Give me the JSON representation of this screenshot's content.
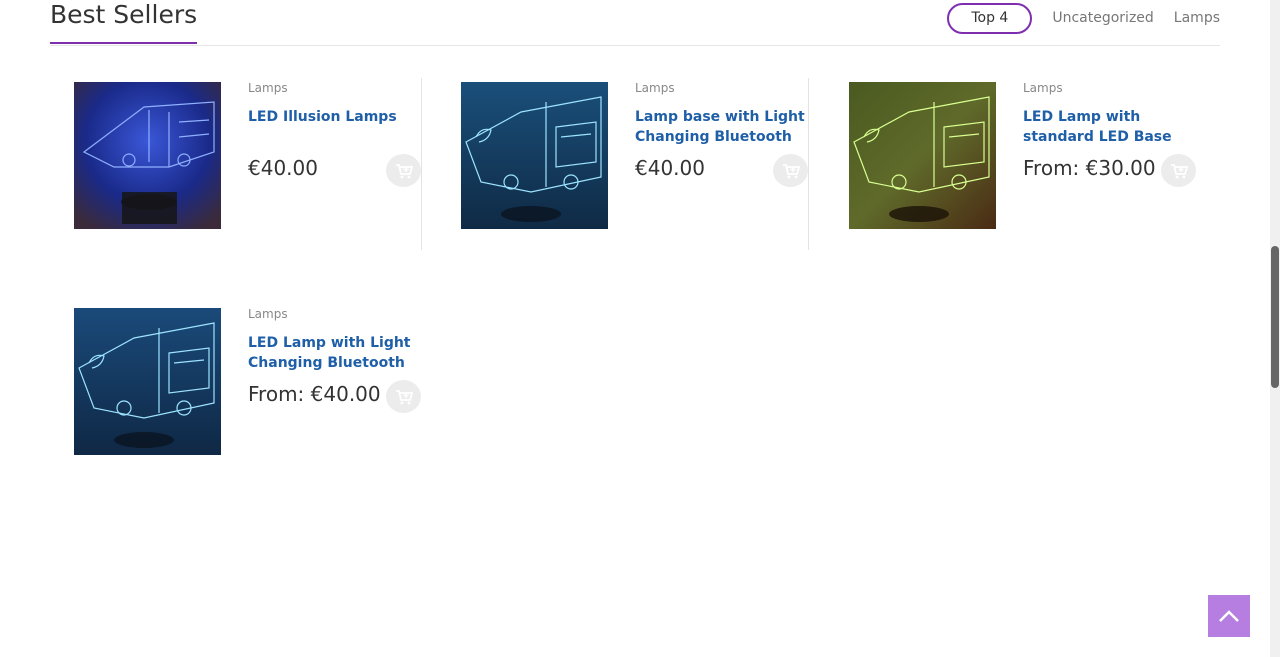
{
  "section": {
    "title": "Best Sellers",
    "tabs": [
      {
        "label": "Top 4"
      },
      {
        "label": "Uncategorized"
      },
      {
        "label": "Lamps"
      }
    ]
  },
  "products": [
    {
      "category": "Lamps",
      "name": "LED Illusion Lamps",
      "price": "€40.00"
    },
    {
      "category": "Lamps",
      "name": "Lamp base with Light Changing Bluetooth",
      "price": "€40.00"
    },
    {
      "category": "Lamps",
      "name": "LED Lamp with standard LED Base",
      "price": "From: €30.00"
    },
    {
      "category": "Lamps",
      "name": "LED Lamp with Light Changing Bluetooth",
      "price": "From: €40.00"
    }
  ],
  "colors": {
    "accent": "#7e2fb0",
    "link": "#1f5fa8",
    "back_to_top": "#b57ee0"
  },
  "icons": {
    "cart": "cart-plus-icon",
    "back_to_top": "chevron-up-icon"
  }
}
